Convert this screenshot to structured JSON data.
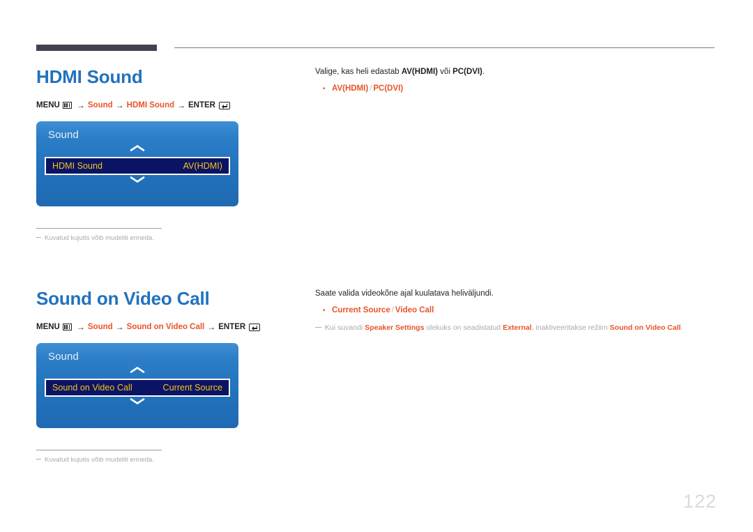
{
  "page": {
    "number": "122"
  },
  "sections": [
    {
      "title": "HDMI Sound",
      "path": {
        "menu_label": "MENU",
        "menu_icon": "menu-grid-icon",
        "steps": [
          "Sound",
          "HDMI Sound"
        ],
        "enter_label": "ENTER",
        "enter_icon": "enter-return-icon",
        "arrow": "→"
      },
      "osd": {
        "title": "Sound",
        "up_icon": "chevron-up-icon",
        "down_icon": "chevron-down-icon",
        "row_label": "HDMI Sound",
        "row_value": "AV(HDMI)"
      },
      "footnote": "Kuvatud kujutis võib mudeliti erineda.",
      "right": {
        "intro_pre": "Valige, kas heli edastab ",
        "intro_bold1": "AV(HDMI)",
        "intro_mid": " või ",
        "intro_bold2": "PC(DVI)",
        "intro_post": ".",
        "bullet_dot": "•",
        "option1": "AV(HDMI)",
        "option_sep": "/",
        "option2": "PC(DVI)"
      }
    },
    {
      "title": "Sound on Video Call",
      "path": {
        "menu_label": "MENU",
        "menu_icon": "menu-grid-icon",
        "steps": [
          "Sound",
          "Sound on Video Call"
        ],
        "enter_label": "ENTER",
        "enter_icon": "enter-return-icon",
        "arrow": "→"
      },
      "osd": {
        "title": "Sound",
        "up_icon": "chevron-up-icon",
        "down_icon": "chevron-down-icon",
        "row_label": "Sound on Video Call",
        "row_value": "Current Source"
      },
      "footnote": "Kuvatud kujutis võib mudeliti erineda.",
      "right": {
        "intro": "Saate valida videokõne ajal kuulatava heliväljundi.",
        "bullet_dot": "•",
        "option1": "Current Source",
        "option_sep": "/",
        "option2": "Video Call",
        "note_pre": "Kui suvandi ",
        "note_kw1": "Speaker Settings",
        "note_mid1": " olekuks on seadistatud ",
        "note_kw2": "External",
        "note_mid2": ", inaktiveeritakse režiim ",
        "note_kw3": "Sound on Video Call",
        "note_post": "."
      }
    }
  ],
  "colors": {
    "title_blue": "#2272bc",
    "accent_orange": "#e8542a",
    "osd_highlight_navy": "#0b1464",
    "osd_value_yellow": "#f5c518",
    "muted_gray": "#a9a9b2",
    "header_bar_dark": "#454152"
  }
}
